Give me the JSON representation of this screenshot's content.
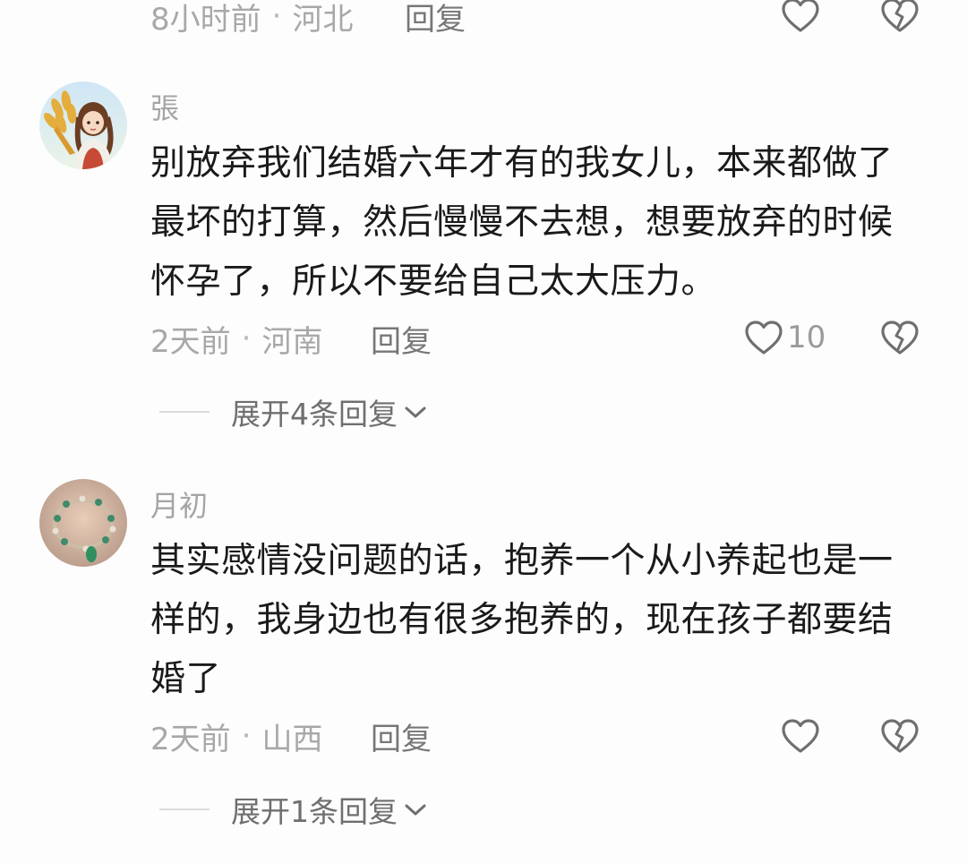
{
  "comments": [
    {
      "time": "8小时前",
      "separator": "·",
      "location": "河北",
      "reply_label": "回复",
      "like_icon": "heart-outline-icon",
      "dislike_icon": "broken-heart-icon"
    },
    {
      "username": "張",
      "avatar_icon": "avatar-wheat-girl",
      "text_lines": [
        "别放弃我们结婚六年才有的我女儿，本来都做了",
        "最坏的打算，然后慢慢不去想，想要放弃的时候",
        "怀孕了，所以不要给自己太大压力。"
      ],
      "time": "2天前",
      "separator": "·",
      "location": "河南",
      "reply_label": "回复",
      "like_count": "10",
      "expand_label": "展开4条回复",
      "like_icon": "heart-outline-icon",
      "dislike_icon": "broken-heart-icon"
    },
    {
      "username": "月初",
      "avatar_icon": "avatar-bracelet",
      "text_lines": [
        "其实感情没问题的话，抱养一个从小养起也是一",
        "样的，我身边也有很多抱养的，现在孩子都要结",
        "婚了"
      ],
      "time": "2天前",
      "separator": "·",
      "location": "山西",
      "reply_label": "回复",
      "expand_label": "展开1条回复",
      "like_icon": "heart-outline-icon",
      "dislike_icon": "broken-heart-icon"
    }
  ],
  "colors": {
    "background": "#fdfdfd",
    "text_primary": "#1a1a1a",
    "text_secondary": "#a8a8a8",
    "icon": "#6f6f6f"
  }
}
